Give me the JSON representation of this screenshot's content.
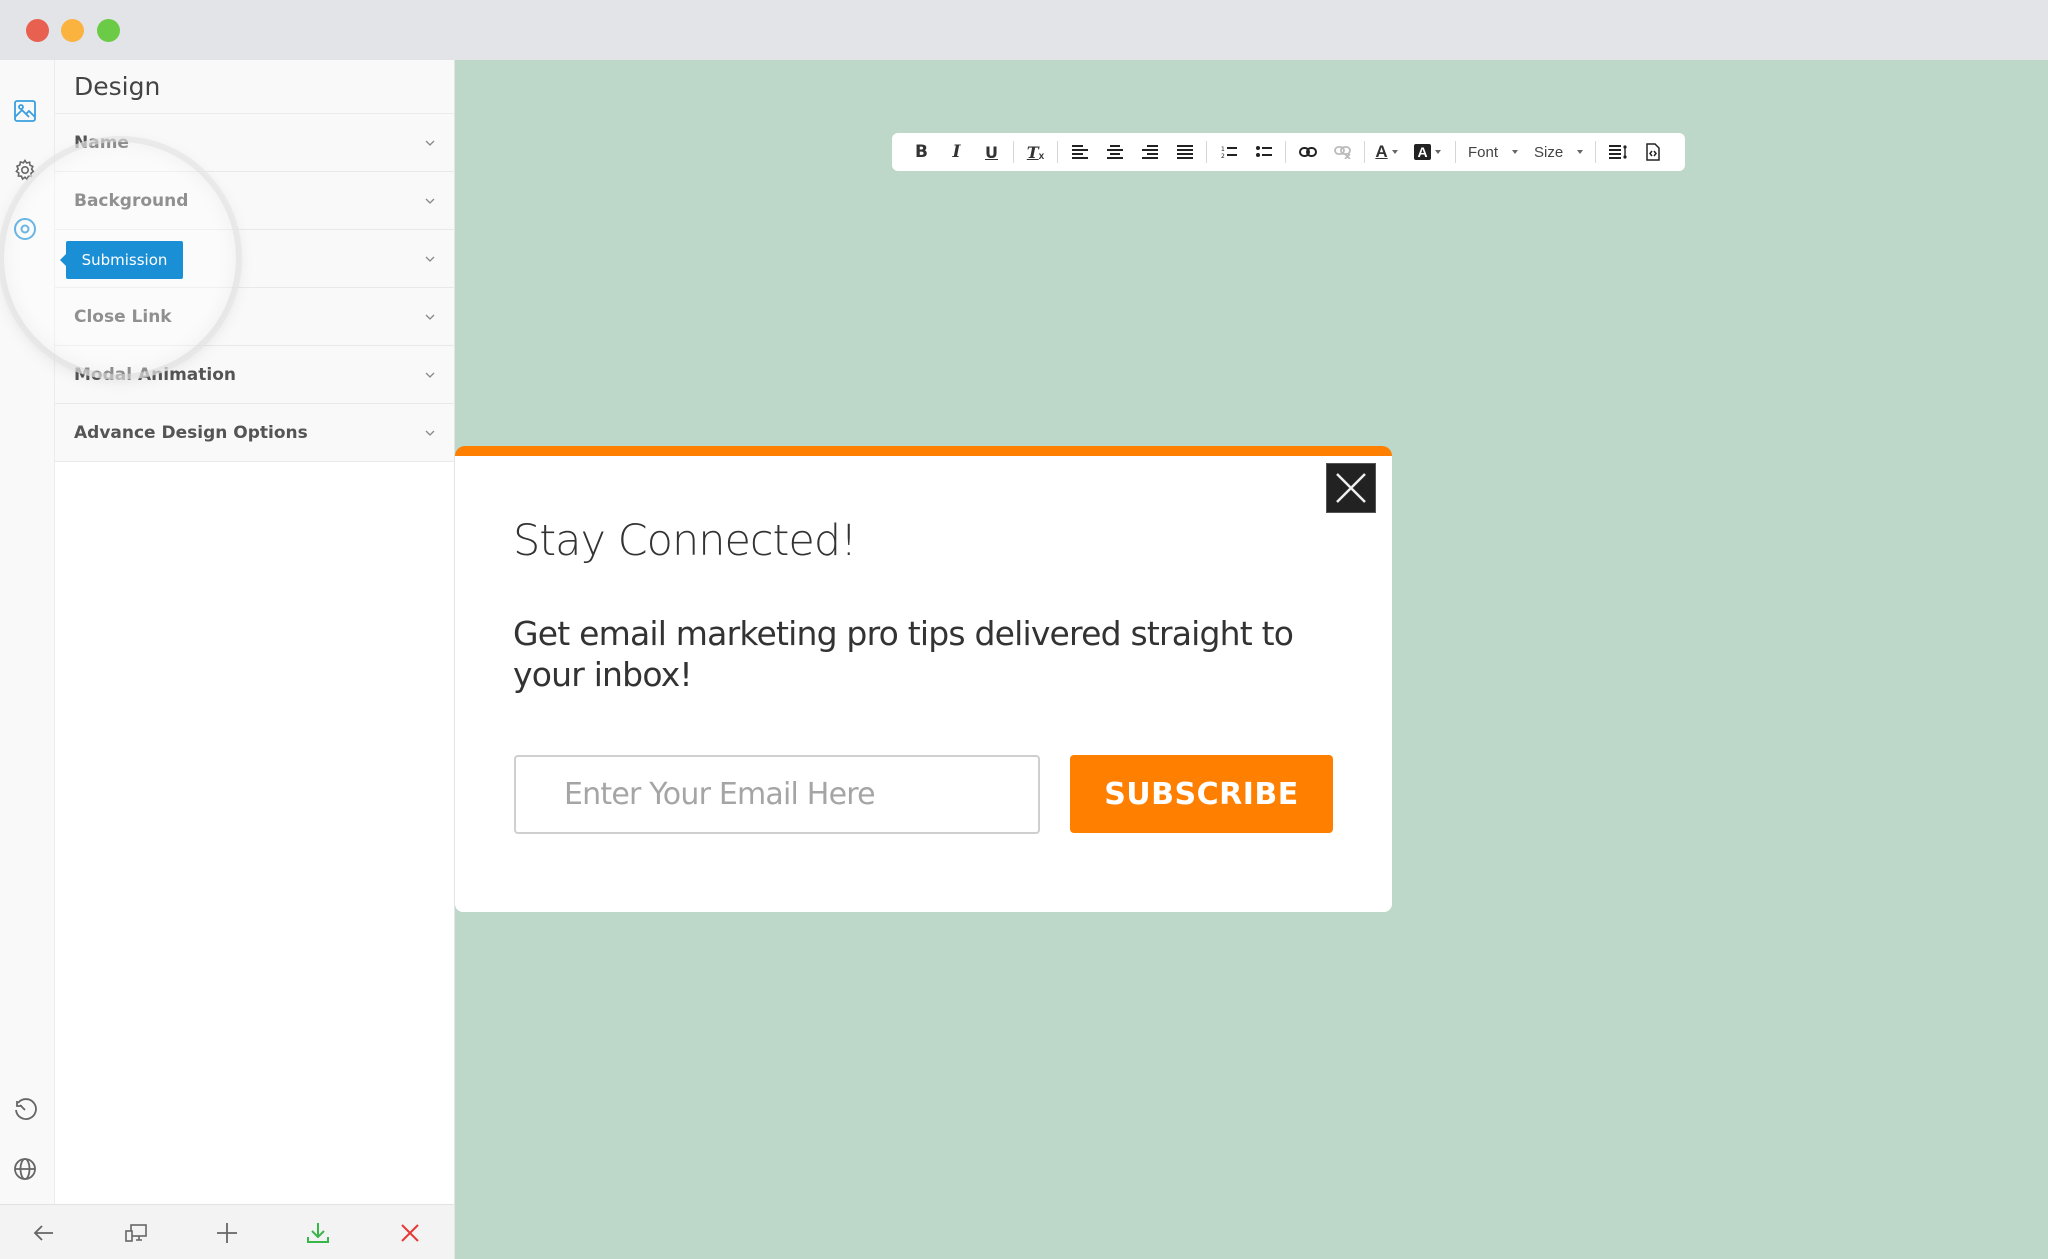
{
  "window": {
    "controls": [
      "close",
      "minimize",
      "maximize"
    ]
  },
  "sidebar": {
    "rail_top_icons": [
      {
        "icon": "image-icon",
        "color": "#3a9fe0"
      },
      {
        "icon": "gear-icon",
        "color": "#666666"
      },
      {
        "icon": "target-icon",
        "color": "#1a8fd6"
      }
    ],
    "rail_bottom_icons": [
      {
        "icon": "history-icon"
      },
      {
        "icon": "globe-icon"
      }
    ],
    "panel_title": "Design",
    "sections": [
      {
        "label": "Name"
      },
      {
        "label": "Background"
      },
      {
        "label": "Submission"
      },
      {
        "label": "Close Link"
      },
      {
        "label": "Modal Animation"
      },
      {
        "label": "Advance Design Options"
      }
    ],
    "tooltip": "Submission",
    "bottom_bar": [
      {
        "icon": "back-arrow-icon",
        "color": "#666666"
      },
      {
        "icon": "responsive-devices-icon",
        "color": "#666666"
      },
      {
        "icon": "plus-icon",
        "color": "#666666"
      },
      {
        "icon": "download-icon",
        "color": "#3ab54a"
      },
      {
        "icon": "close-icon",
        "color": "#e53935"
      }
    ]
  },
  "toolbar": {
    "buttons": [
      "bold",
      "italic",
      "underline",
      "clear-formatting",
      "align-left",
      "align-center",
      "align-right",
      "align-justify",
      "ordered-list",
      "unordered-list",
      "link",
      "unlink",
      "text-color",
      "background-color"
    ],
    "font_label": "Font",
    "size_label": "Size",
    "extra_buttons": [
      "line-height",
      "source-code"
    ]
  },
  "modal": {
    "accent_color": "#ff7f00",
    "title": "Stay Connected!",
    "description": "Get email marketing pro tips delivered straight to your inbox!",
    "email_placeholder": "Enter Your Email Here",
    "email_value": "",
    "subscribe_label": "SUBSCRIBE"
  },
  "canvas": {
    "background_color": "#bdd8c8"
  }
}
